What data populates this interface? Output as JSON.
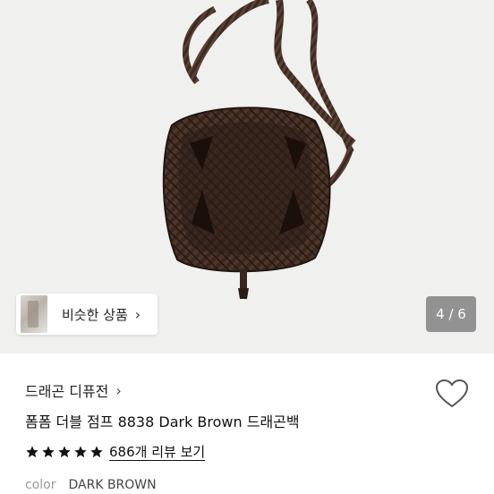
{
  "gallery": {
    "similar_button_label": "비슷한 상품",
    "page_counter": "4 / 6",
    "current_page": 4,
    "total_pages": 6
  },
  "product": {
    "brand": "드래곤 디퓨전",
    "title": "폼폼 더블 점프 8838 Dark Brown 드래곤백",
    "rating_stars": 5,
    "review_link": "686개 리뷰 보기",
    "color_label": "color",
    "color_value": "DARK BROWN"
  },
  "icons": {
    "similar_chevron": "chevron-right-icon",
    "brand_chevron": "chevron-right-icon",
    "wishlist": "heart-outline-icon",
    "rating": "star-filled-icon"
  },
  "colors": {
    "star": "#111111",
    "counter_bg": "#6e6e6e",
    "hero_bg": "#f0f0ef",
    "bag_leather": "#3b2a22"
  }
}
